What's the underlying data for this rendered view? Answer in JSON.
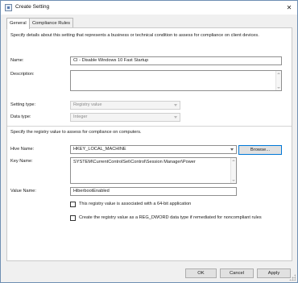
{
  "window": {
    "title": "Create Setting",
    "close_glyph": "✕",
    "icon": "app-icon"
  },
  "tabs": [
    {
      "label": "General",
      "active": true
    },
    {
      "label": "Compliance Rules",
      "active": false
    }
  ],
  "general": {
    "intro": "Specify details about this setting that represents a business or technical condition to assess for compliance on client devices.",
    "name_label": "Name:",
    "name_value": "CI - Disable Windows 10 Fast Startup",
    "description_label": "Description:",
    "description_value": "",
    "setting_type_label": "Setting type:",
    "setting_type_value": "Registry value",
    "data_type_label": "Data type:",
    "data_type_value": "Integer",
    "registry_intro": "Specify the registry value to assess for compliance on computers.",
    "hive_label": "Hive Name:",
    "hive_value": "HKEY_LOCAL_MACHINE",
    "browse_label": "Browse...",
    "key_label": "Key Name:",
    "key_value": "SYSTEM\\CurrentControlSet\\Control\\Session Manager\\Power",
    "value_name_label": "Value Name:",
    "value_name_value": "HiberbootEnabled",
    "checkbox_64bit_label": "This registry value is associated with a 64-bit application",
    "checkbox_64bit_checked": false,
    "checkbox_dword_label": "Create the registry value as a REG_DWORD data type if remediated for noncompliant rules",
    "checkbox_dword_checked": false
  },
  "footer": {
    "ok_label": "OK",
    "cancel_label": "Cancel",
    "apply_label": "Apply"
  },
  "colors": {
    "focus_border": "#0078d7",
    "title_border": "#6f8fb3"
  }
}
